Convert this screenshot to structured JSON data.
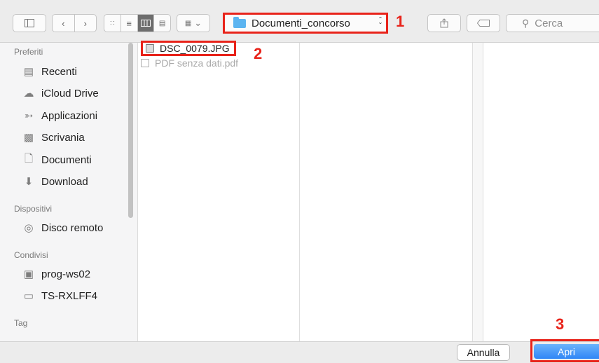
{
  "toolbar": {
    "sidebar_toggle_icon": "sidebar-icon",
    "back_icon": "chevron-left-icon",
    "forward_icon": "chevron-right-icon",
    "views": [
      "icon-view",
      "list-view",
      "column-view",
      "gallery-view"
    ],
    "active_view": "column-view",
    "gallery_chevron": "⌄",
    "path": "Documenti_concorso",
    "share_icon": "share-icon",
    "tag_icon": "tag-icon",
    "search_placeholder": "Cerca"
  },
  "sidebar": {
    "sections": [
      {
        "header": "Preferiti",
        "items": [
          {
            "label": "Recenti",
            "icon": "recents-icon"
          },
          {
            "label": "iCloud Drive",
            "icon": "cloud-icon"
          },
          {
            "label": "Applicazioni",
            "icon": "applications-icon"
          },
          {
            "label": "Scrivania",
            "icon": "desktop-icon"
          },
          {
            "label": "Documenti",
            "icon": "documents-icon"
          },
          {
            "label": "Download",
            "icon": "download-icon"
          }
        ]
      },
      {
        "header": "Dispositivi",
        "items": [
          {
            "label": "Disco remoto",
            "icon": "disc-icon"
          }
        ]
      },
      {
        "header": "Condivisi",
        "items": [
          {
            "label": "prog-ws02",
            "icon": "computer-icon"
          },
          {
            "label": "TS-RXLFF4",
            "icon": "display-icon"
          }
        ]
      },
      {
        "header": "Tag",
        "items": []
      }
    ]
  },
  "files": [
    {
      "name": "DSC_0079.JPG",
      "enabled": true
    },
    {
      "name": "PDF senza dati.pdf",
      "enabled": false
    }
  ],
  "callouts": [
    "1",
    "2",
    "3"
  ],
  "buttons": {
    "cancel": "Annulla",
    "open": "Apri"
  },
  "colors": {
    "accent_blue": "#2f86f6",
    "highlight_red": "#e8231a"
  }
}
